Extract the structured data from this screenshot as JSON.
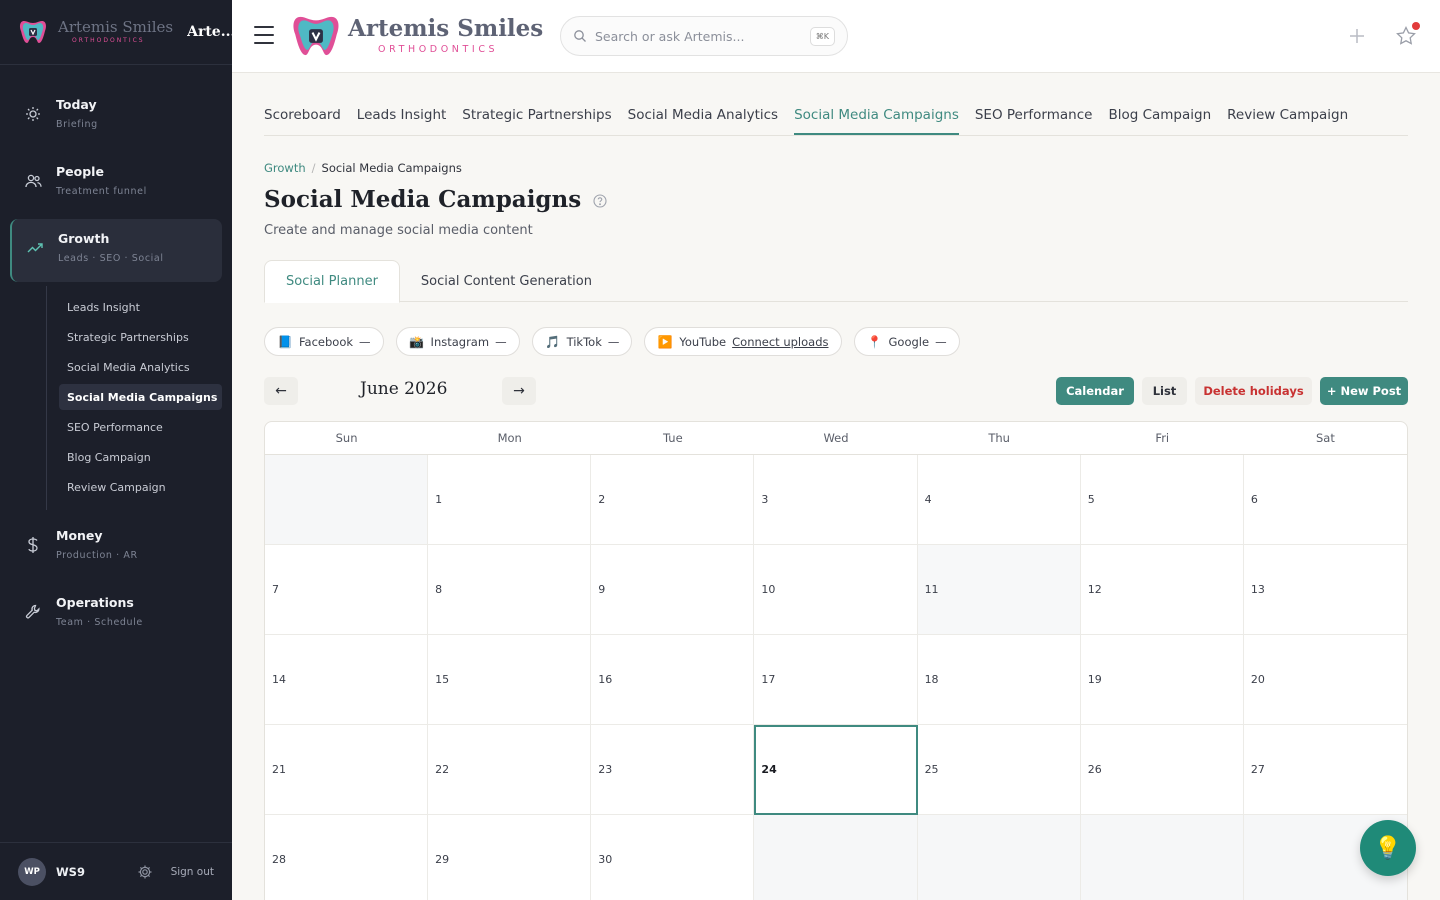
{
  "sidebar": {
    "brand_name": "Artemis Smiles",
    "brand_sub": "ORTHODONTICS",
    "brand_short": "Arte...",
    "items": [
      {
        "title": "Today",
        "sub": "Briefing"
      },
      {
        "title": "People",
        "sub": "Treatment funnel"
      },
      {
        "title": "Growth",
        "sub": "Leads · SEO · Social"
      },
      {
        "title": "Money",
        "sub": "Production · AR"
      },
      {
        "title": "Operations",
        "sub": "Team · Schedule"
      }
    ],
    "subitems": [
      "Leads Insight",
      "Strategic Partnerships",
      "Social Media Analytics",
      "Social Media Campaigns",
      "SEO Performance",
      "Blog Campaign",
      "Review Campaign"
    ],
    "user_initials": "WP",
    "user_name": "WS9",
    "signout": "Sign out"
  },
  "topbar": {
    "brand_name": "Artemis Smiles",
    "brand_sub": "ORTHODONTICS",
    "search_placeholder": "Search or ask Artemis...",
    "search_kbd": "⌘K"
  },
  "tabs": [
    "Scoreboard",
    "Leads Insight",
    "Strategic Partnerships",
    "Social Media Analytics",
    "Social Media Campaigns",
    "SEO Performance",
    "Blog Campaign",
    "Review Campaign"
  ],
  "breadcrumb": {
    "parent": "Growth",
    "sep": "/",
    "current": "Social Media Campaigns"
  },
  "page": {
    "title": "Social Media Campaigns",
    "subtitle": "Create and manage social media content"
  },
  "subtabs": [
    "Social Planner",
    "Social Content Generation"
  ],
  "chips": [
    {
      "icon": "📘",
      "label": "Facebook",
      "status": "—"
    },
    {
      "icon": "📸",
      "label": "Instagram",
      "status": "—"
    },
    {
      "icon": "🎵",
      "label": "TikTok",
      "status": "—"
    },
    {
      "icon": "▶️",
      "label": "YouTube",
      "link": "Connect uploads"
    },
    {
      "icon": "📍",
      "label": "Google",
      "status": "—"
    }
  ],
  "calendar": {
    "prev": "←",
    "next": "→",
    "month": "June 2026",
    "btn_calendar": "Calendar",
    "btn_list": "List",
    "btn_delete": "Delete holidays",
    "btn_new": "+ New Post",
    "weekdays": [
      "Sun",
      "Mon",
      "Tue",
      "Wed",
      "Thu",
      "Fri",
      "Sat"
    ],
    "days": [
      "",
      "1",
      "2",
      "3",
      "4",
      "5",
      "6",
      "7",
      "8",
      "9",
      "10",
      "11",
      "12",
      "13",
      "14",
      "15",
      "16",
      "17",
      "18",
      "19",
      "20",
      "21",
      "22",
      "23",
      "24",
      "25",
      "26",
      "27",
      "28",
      "29",
      "30",
      "",
      "",
      "",
      ""
    ]
  },
  "fab_icon": "💡",
  "colors": {
    "accent": "#3f8a80",
    "sidebar_bg": "#1c1f2a",
    "danger": "#c83232",
    "brand_pink": "#e04f97"
  }
}
